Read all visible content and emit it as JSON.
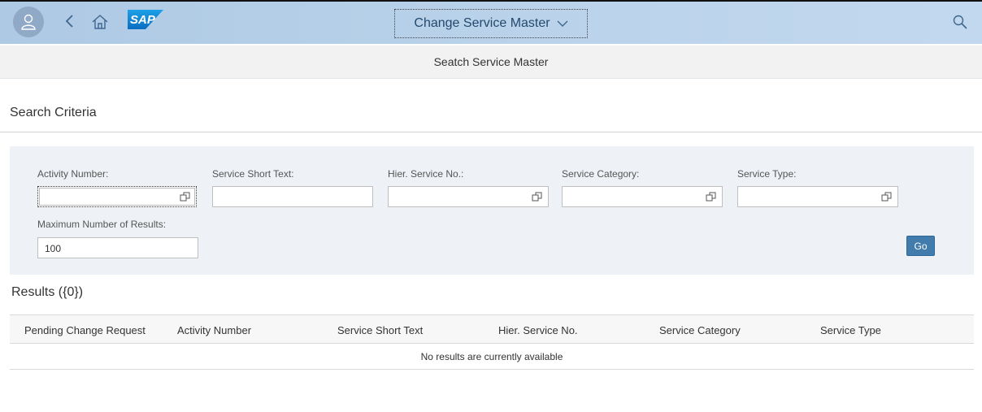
{
  "shell": {
    "app_title": "Change Service Master",
    "logo_text": "SAP",
    "colors": {
      "header_bg": "#b9d2ea",
      "icon": "#3f6690"
    }
  },
  "page": {
    "subheader": "Seatch Service Master",
    "criteria_title": "Search Criteria"
  },
  "filters": {
    "activity_number_label": "Activity Number:",
    "activity_number_value": "",
    "service_short_text_label": "Service Short Text:",
    "service_short_text_value": "",
    "hier_service_no_label": "Hier. Service No.:",
    "hier_service_no_value": "",
    "service_category_label": "Service Category:",
    "service_category_value": "",
    "service_type_label": "Service Type:",
    "service_type_value": "",
    "max_results_label": "Maximum Number of Results:",
    "max_results_value": "100",
    "go_label": "Go",
    "colors": {
      "filter_bg": "#eef2f6",
      "go_bg": "#427cac"
    }
  },
  "results": {
    "title": "Results ({0})",
    "columns": [
      "Pending Change Request",
      "Activity Number",
      "Service Short Text",
      "Hier. Service No.",
      "Service Category",
      "Service Type"
    ],
    "empty_text": "No results are currently available"
  }
}
